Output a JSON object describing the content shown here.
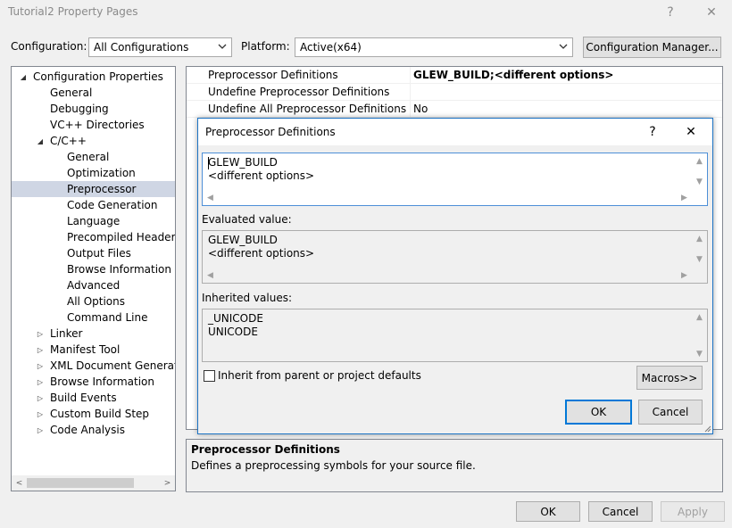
{
  "window": {
    "title": "Tutorial2 Property Pages",
    "help_glyph": "?",
    "close_glyph": "✕"
  },
  "toolbar": {
    "configuration_label": "Configuration:",
    "configuration_value": "All Configurations",
    "platform_label": "Platform:",
    "platform_value": "Active(x64)",
    "config_manager_label": "Configuration Manager..."
  },
  "tree": {
    "items": [
      {
        "label": "Configuration Properties",
        "expander": "◢"
      },
      {
        "label": "General"
      },
      {
        "label": "Debugging"
      },
      {
        "label": "VC++ Directories"
      },
      {
        "label": "C/C++",
        "expander": "◢"
      },
      {
        "label": "General"
      },
      {
        "label": "Optimization"
      },
      {
        "label": "Preprocessor",
        "selected": true
      },
      {
        "label": "Code Generation"
      },
      {
        "label": "Language"
      },
      {
        "label": "Precompiled Headers"
      },
      {
        "label": "Output Files"
      },
      {
        "label": "Browse Information"
      },
      {
        "label": "Advanced"
      },
      {
        "label": "All Options"
      },
      {
        "label": "Command Line"
      },
      {
        "label": "Linker",
        "expander": "▷"
      },
      {
        "label": "Manifest Tool",
        "expander": "▷"
      },
      {
        "label": "XML Document Generator",
        "expander": "▷"
      },
      {
        "label": "Browse Information",
        "expander": "▷"
      },
      {
        "label": "Build Events",
        "expander": "▷"
      },
      {
        "label": "Custom Build Step",
        "expander": "▷"
      },
      {
        "label": "Code Analysis",
        "expander": "▷"
      }
    ],
    "scroll_left": "<",
    "scroll_right": ">"
  },
  "grid": {
    "rows": [
      {
        "name": "Preprocessor Definitions",
        "value": "GLEW_BUILD;<different options>",
        "bold": true
      },
      {
        "name": "Undefine Preprocessor Definitions",
        "value": ""
      },
      {
        "name": "Undefine All Preprocessor Definitions",
        "value": "No"
      }
    ]
  },
  "description": {
    "title": "Preprocessor Definitions",
    "text": "Defines a preprocessing symbols for your source file."
  },
  "footer": {
    "ok": "OK",
    "cancel": "Cancel",
    "apply": "Apply"
  },
  "dialog": {
    "title": "Preprocessor Definitions",
    "help_glyph": "?",
    "close_glyph": "✕",
    "edit_lines": [
      "GLEW_BUILD",
      "<different options>"
    ],
    "evaluated_label": "Evaluated value:",
    "evaluated_lines": [
      "GLEW_BUILD",
      "<different options>"
    ],
    "inherited_label": "Inherited values:",
    "inherited_lines": [
      "_UNICODE",
      "UNICODE"
    ],
    "inherit_checkbox_label": "Inherit from parent or project defaults",
    "inherit_checked": false,
    "macros_button": "Macros>>",
    "ok": "OK",
    "cancel": "Cancel"
  },
  "colors": {
    "selection": "#cfd6e4",
    "dialog_border": "#1c73c4",
    "focus_border": "#4d8fd7"
  }
}
